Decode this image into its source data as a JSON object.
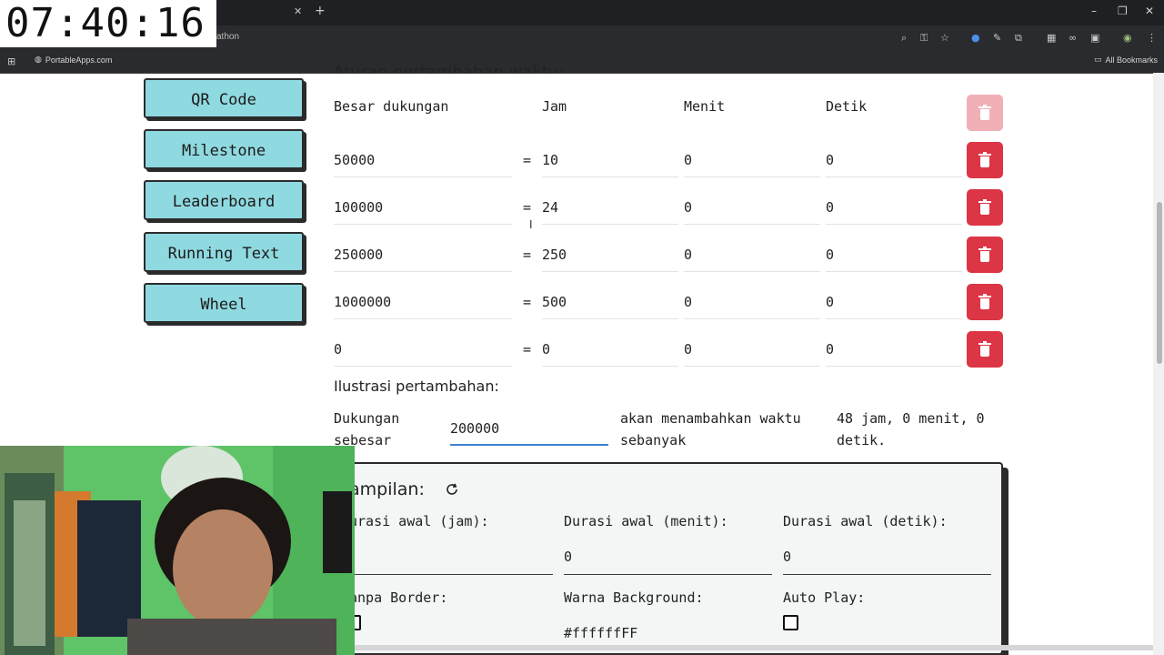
{
  "clock": {
    "time": "07:40:16"
  },
  "browser": {
    "url_fragment": "athon",
    "bookmarks": [
      {
        "label": "PortableApps.com"
      }
    ],
    "all_bookmarks_label": "All Bookmarks",
    "tab_close": "✕",
    "tab_new": "+"
  },
  "sidebar": {
    "items": [
      {
        "label": "QR Code"
      },
      {
        "label": "Milestone"
      },
      {
        "label": "Leaderboard"
      },
      {
        "label": "Running Text"
      },
      {
        "label": "Wheel"
      }
    ]
  },
  "rules": {
    "section_title_partial": "Aturan pertambahan waktu:",
    "headers": {
      "support": "Besar dukungan",
      "hours": "Jam",
      "minutes": "Menit",
      "seconds": "Detik"
    },
    "rows": [
      {
        "support": "50000",
        "hours": "10",
        "minutes": "0",
        "seconds": "0"
      },
      {
        "support": "100000",
        "hours": "24",
        "minutes": "0",
        "seconds": "0"
      },
      {
        "support": "250000",
        "hours": "250",
        "minutes": "0",
        "seconds": "0"
      },
      {
        "support": "1000000",
        "hours": "500",
        "minutes": "0",
        "seconds": "0"
      },
      {
        "support": "0",
        "hours": "0",
        "minutes": "0",
        "seconds": "0"
      }
    ],
    "equals": "="
  },
  "illustration": {
    "title": "Ilustrasi pertambahan:",
    "support_label_1": "Dukungan",
    "support_label_2": "sebesar",
    "support_value": "200000",
    "adds_label_1": "akan menambahkan waktu",
    "adds_label_2": "sebanyak",
    "result_1": "48 jam, 0 menit, 0",
    "result_2": "detik."
  },
  "display": {
    "title_partial": "ampilan:",
    "initial_hours_label": "urasi awal (jam):",
    "initial_minutes_label": "Durasi awal (menit):",
    "initial_seconds_label": "Durasi awal (detik):",
    "initial_minutes_value": "0",
    "initial_seconds_value": "0",
    "no_border_label": "anpa Border:",
    "background_color_label": "Warna Background:",
    "background_color_value": "#ffffffFF",
    "autoplay_label": "Auto Play:",
    "autoplay_checked": false
  },
  "colors": {
    "sidebar_button": "#8fd9e0",
    "delete_button": "#dc3545",
    "focus_underline": "#3d7fd6",
    "panel_bg": "#f3f6f5"
  }
}
